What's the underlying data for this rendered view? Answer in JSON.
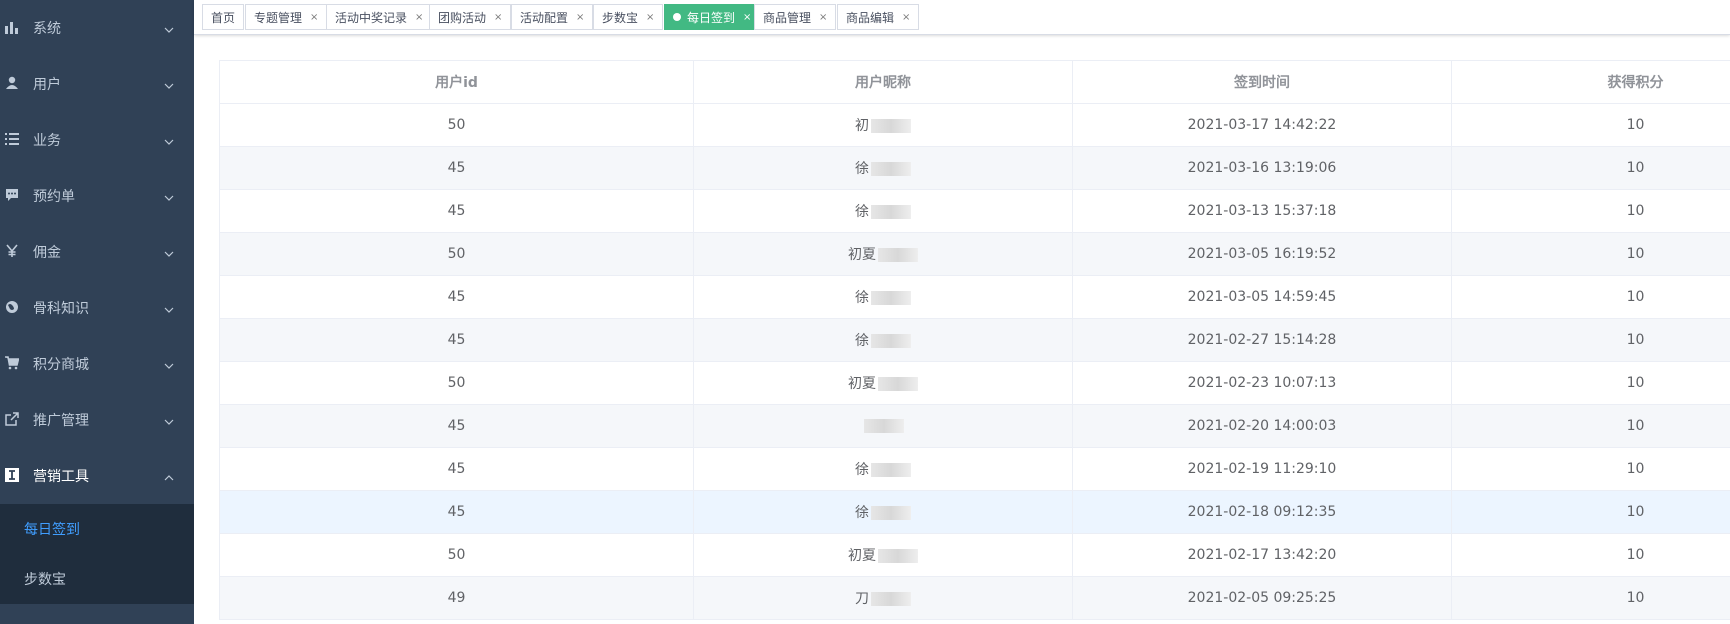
{
  "sidebar": {
    "menu": [
      {
        "label": "系统",
        "icon": "bar-chart-icon"
      },
      {
        "label": "用户",
        "icon": "user-icon"
      },
      {
        "label": "业务",
        "icon": "list-icon"
      },
      {
        "label": "预约单",
        "icon": "message-icon"
      },
      {
        "label": "佣金",
        "icon": "yen-icon"
      },
      {
        "label": "骨科知识",
        "icon": "globe-icon"
      },
      {
        "label": "积分商城",
        "icon": "cart-icon"
      },
      {
        "label": "推广管理",
        "icon": "external-link-icon"
      },
      {
        "label": "营销工具",
        "icon": "text-cursor-icon"
      }
    ],
    "submenu": [
      {
        "label": "每日签到",
        "active": true
      },
      {
        "label": "步数宝",
        "active": false
      }
    ],
    "colors": {
      "bg": "#304156",
      "submenu_bg": "#1f2d3d",
      "text": "#bfcbd9",
      "active": "#409eff"
    }
  },
  "tags": [
    {
      "label": "首页",
      "closable": false,
      "active": false
    },
    {
      "label": "专题管理",
      "closable": true,
      "active": false
    },
    {
      "label": "活动中奖记录",
      "closable": true,
      "active": false
    },
    {
      "label": "团购活动",
      "closable": true,
      "active": false
    },
    {
      "label": "活动配置",
      "closable": true,
      "active": false
    },
    {
      "label": "步数宝",
      "closable": true,
      "active": false
    },
    {
      "label": "每日签到",
      "closable": true,
      "active": true
    },
    {
      "label": "商品管理",
      "closable": true,
      "active": false
    },
    {
      "label": "商品编辑",
      "closable": true,
      "active": false
    }
  ],
  "tag_close_glyph": "×",
  "table": {
    "columns": [
      "用户id",
      "用户昵称",
      "签到时间",
      "获得积分"
    ],
    "rows": [
      {
        "user_id": "50",
        "nickname": "初",
        "time": "2021-03-17 14:42:22",
        "points": "10"
      },
      {
        "user_id": "45",
        "nickname": "徐",
        "time": "2021-03-16 13:19:06",
        "points": "10"
      },
      {
        "user_id": "45",
        "nickname": "徐",
        "time": "2021-03-13 15:37:18",
        "points": "10"
      },
      {
        "user_id": "50",
        "nickname": "初夏",
        "time": "2021-03-05 16:19:52",
        "points": "10"
      },
      {
        "user_id": "45",
        "nickname": "徐",
        "time": "2021-03-05 14:59:45",
        "points": "10"
      },
      {
        "user_id": "45",
        "nickname": "徐",
        "time": "2021-02-27 15:14:28",
        "points": "10"
      },
      {
        "user_id": "50",
        "nickname": "初夏",
        "time": "2021-02-23 10:07:13",
        "points": "10"
      },
      {
        "user_id": "45",
        "nickname": "",
        "time": "2021-02-20 14:00:03",
        "points": "10"
      },
      {
        "user_id": "45",
        "nickname": "徐",
        "time": "2021-02-19 11:29:10",
        "points": "10"
      },
      {
        "user_id": "45",
        "nickname": "徐",
        "time": "2021-02-18 09:12:35",
        "points": "10"
      },
      {
        "user_id": "50",
        "nickname": "初夏",
        "time": "2021-02-17 13:42:20",
        "points": "10"
      },
      {
        "user_id": "49",
        "nickname": "刀",
        "time": "2021-02-05 09:25:25",
        "points": "10"
      }
    ]
  },
  "accent": {
    "tag_active": "#42b983"
  }
}
